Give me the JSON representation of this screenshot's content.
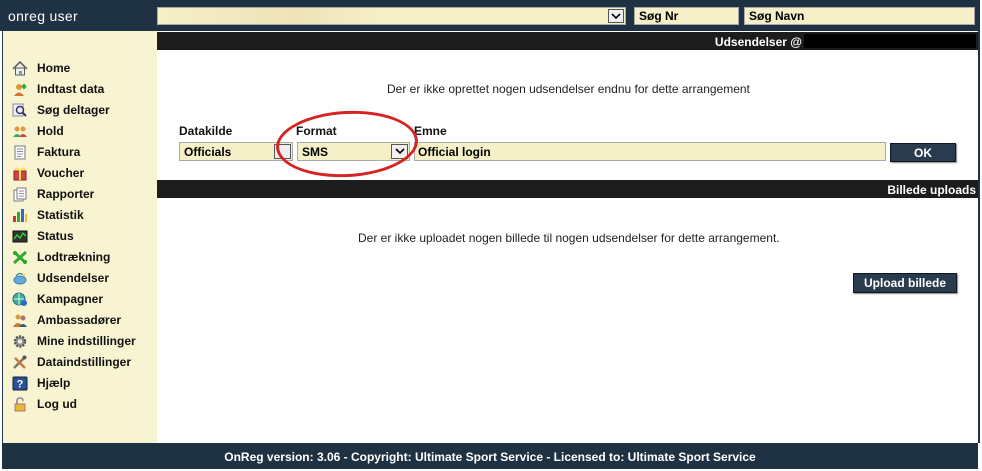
{
  "header": {
    "app_title": "onreg user",
    "search_nr": "Søg Nr",
    "search_navn": "Søg Navn"
  },
  "sidebar": {
    "items": [
      {
        "label": "Home",
        "icon": "home-icon"
      },
      {
        "label": "Indtast data",
        "icon": "add-user-icon"
      },
      {
        "label": "Søg deltager",
        "icon": "search-icon"
      },
      {
        "label": "Hold",
        "icon": "team-icon"
      },
      {
        "label": "Faktura",
        "icon": "invoice-icon"
      },
      {
        "label": "Voucher",
        "icon": "gift-icon"
      },
      {
        "label": "Rapporter",
        "icon": "report-icon"
      },
      {
        "label": "Statistik",
        "icon": "bar-chart-icon"
      },
      {
        "label": "Status",
        "icon": "status-icon"
      },
      {
        "label": "Lodtrækning",
        "icon": "lottery-icon"
      },
      {
        "label": "Udsendelser",
        "icon": "broadcast-icon"
      },
      {
        "label": "Kampagner",
        "icon": "campaign-icon"
      },
      {
        "label": "Ambassadører",
        "icon": "ambassador-icon"
      },
      {
        "label": "Mine indstillinger",
        "icon": "gear-icon"
      },
      {
        "label": "Dataindstillinger",
        "icon": "tools-icon"
      },
      {
        "label": "Hjælp",
        "icon": "help-icon"
      },
      {
        "label": "Log ud",
        "icon": "lock-icon"
      }
    ]
  },
  "broadcasts": {
    "section_title": "Udsendelser @",
    "empty_message": "Der er ikke oprettet nogen udsendelser endnu for dette arrangement",
    "datakilde_label": "Datakilde",
    "datakilde_value": "Officials",
    "format_label": "Format",
    "format_value": "SMS",
    "emne_label": "Emne",
    "emne_value": "Official login",
    "ok_label": "OK"
  },
  "uploads": {
    "section_title": "Billede uploads",
    "empty_message": "Der er ikke uploadet nogen billede til nogen udsendelser for dette arrangement.",
    "upload_label": "Upload billede"
  },
  "footer": {
    "text": "OnReg version: 3.06 - Copyright: Ultimate Sport Service - Licensed to: Ultimate Sport Service"
  },
  "colors": {
    "header_bg": "#1f3244",
    "sidebar_bg": "#f8f4d2",
    "input_bg": "#f5f0c8",
    "annotation_red": "#d62424"
  }
}
